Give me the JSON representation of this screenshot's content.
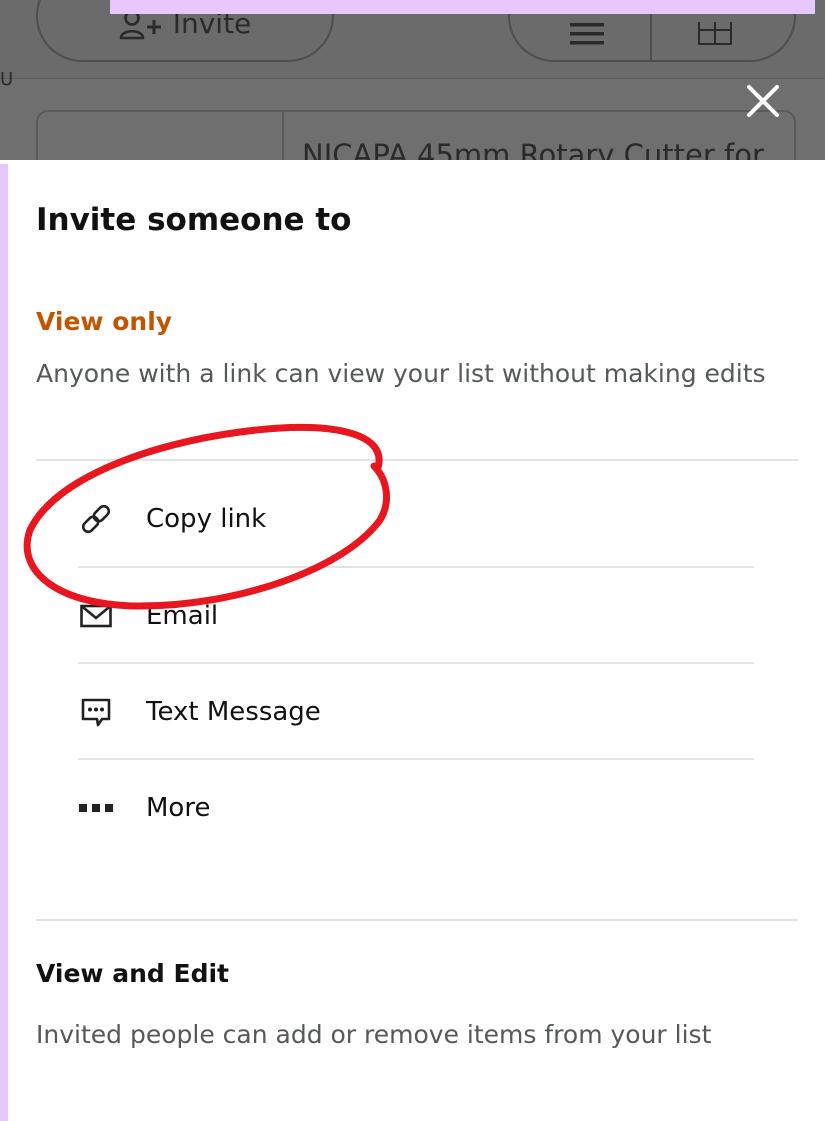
{
  "background": {
    "invite_label": "Invite",
    "product_title": "NICAPA 45mm Rotary Cutter for",
    "stray_letter": "U"
  },
  "sheet": {
    "title": "Invite someone to",
    "view_only": {
      "heading": "View only",
      "description": "Anyone with a link can view your list without making edits"
    },
    "share_options": [
      {
        "label": "Copy link",
        "icon": "link-icon"
      },
      {
        "label": "Email",
        "icon": "envelope-icon"
      },
      {
        "label": "Text Message",
        "icon": "chat-bubble-icon"
      },
      {
        "label": "More",
        "icon": "more-dots-icon"
      }
    ],
    "view_edit": {
      "heading": "View and Edit",
      "description": "Invited people can add or remove items from your list"
    }
  },
  "colors": {
    "accent_orange": "#c45500",
    "annotation_red": "#e8161e",
    "frame_lilac": "#e6c8fb",
    "overlay_gray": "#6f6f6f"
  }
}
